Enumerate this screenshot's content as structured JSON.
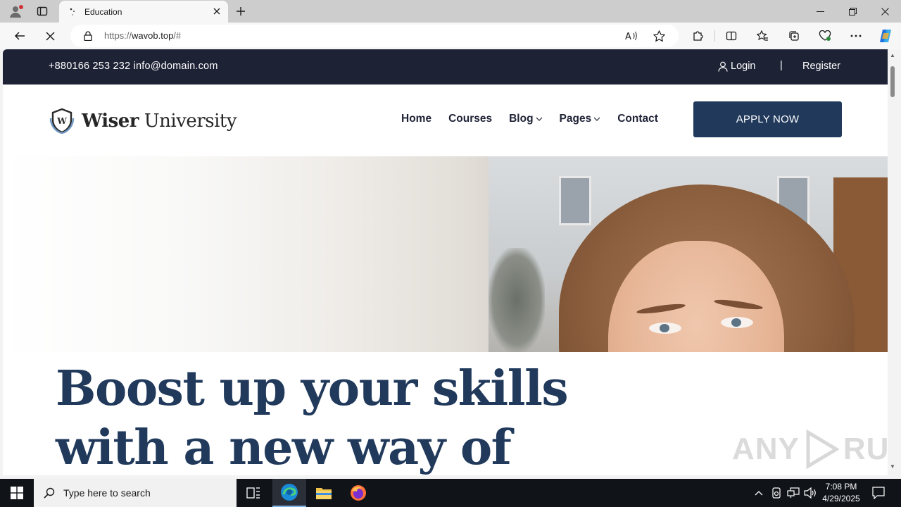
{
  "browser": {
    "tab_title": "Education",
    "url_prefix": "https://",
    "url_host": "wavob.top",
    "url_suffix": "/#"
  },
  "page": {
    "topbar": {
      "contact": "+880166 253 232 info@domain.com",
      "login": "Login",
      "separator": "|",
      "register": "Register"
    },
    "logo": {
      "bold": "Wiser",
      "rest": "University",
      "badge_letter": "W"
    },
    "nav": {
      "home": "Home",
      "courses": "Courses",
      "blog": "Blog",
      "pages": "Pages",
      "contact": "Contact"
    },
    "apply_button": "APPLY NOW",
    "headline_line1": "Boost up your skills",
    "headline_line2": "with a new way of"
  },
  "watermark": {
    "left": "ANY",
    "right": "RUN"
  },
  "taskbar": {
    "search_placeholder": "Type here to search",
    "time": "7:08 PM",
    "date": "4/29/2025"
  },
  "colors": {
    "topbar_bg": "#1e2235",
    "brand_navy": "#213a5c",
    "taskbar_bg": "#101318"
  }
}
